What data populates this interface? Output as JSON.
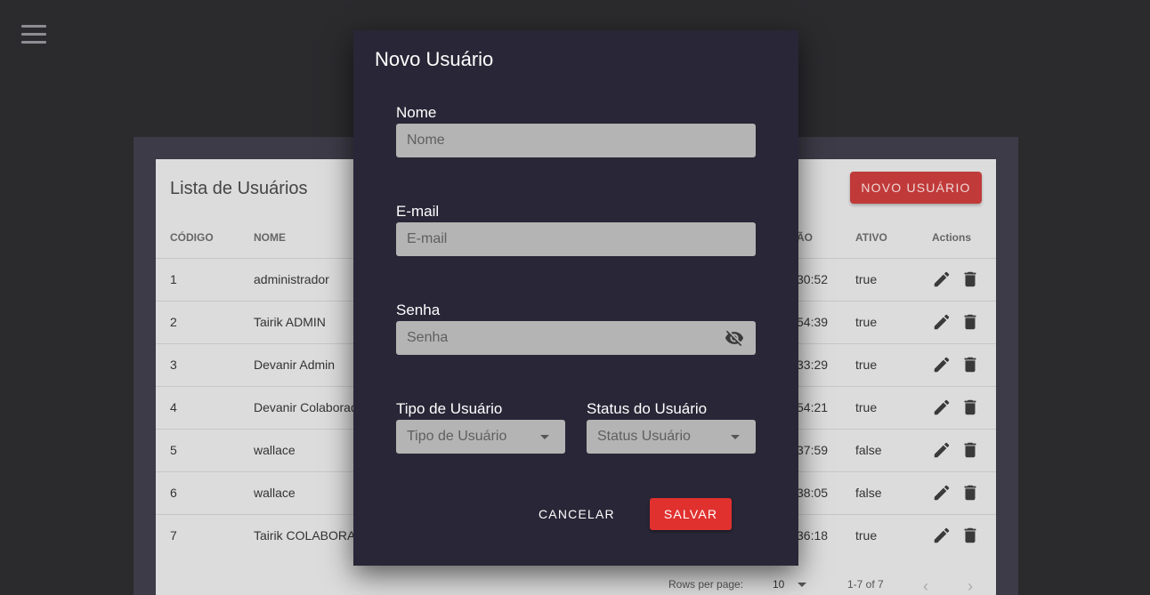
{
  "list": {
    "title": "Lista de Usuários",
    "new_button": "NOVO USUÁRIO",
    "headers": {
      "codigo": "CÓDIGO",
      "nome": "NOME",
      "partial": "ÃO",
      "ativo": "ATIVO",
      "actions": "Actions"
    },
    "rows": [
      {
        "codigo": "1",
        "nome": "administrador",
        "partial": "30:52",
        "ativo": "true"
      },
      {
        "codigo": "2",
        "nome": "Tairik ADMIN",
        "partial": "54:39",
        "ativo": "true"
      },
      {
        "codigo": "3",
        "nome": "Devanir Admin",
        "partial": "33:29",
        "ativo": "true"
      },
      {
        "codigo": "4",
        "nome": "Devanir Colaborad",
        "partial": "54:21",
        "ativo": "true"
      },
      {
        "codigo": "5",
        "nome": "wallace",
        "partial": "37:59",
        "ativo": "false"
      },
      {
        "codigo": "6",
        "nome": "wallace",
        "partial": "38:05",
        "ativo": "false"
      },
      {
        "codigo": "7",
        "nome": "Tairik COLABORA",
        "partial": "36:18",
        "ativo": "true"
      }
    ],
    "footer": {
      "rows_per_page_label": "Rows per page:",
      "rows_per_page_value": "10",
      "range": "1-7 of 7"
    }
  },
  "dialog": {
    "title": "Novo Usuário",
    "nome": {
      "label": "Nome",
      "placeholder": "Nome"
    },
    "email": {
      "label": "E-mail",
      "placeholder": "E-mail"
    },
    "senha": {
      "label": "Senha",
      "placeholder": "Senha"
    },
    "tipo": {
      "label": "Tipo de Usuário",
      "placeholder": "Tipo de Usuário"
    },
    "status": {
      "label": "Status do Usuário",
      "placeholder": "Status Usuário"
    },
    "cancel": "CANCELAR",
    "save": "SALVAR"
  },
  "icons": {
    "menu": "menu-icon",
    "edit": "pencil-icon",
    "delete": "trash-icon",
    "visibility": "eye-off-icon",
    "prev": "chevron-left-icon",
    "next": "chevron-right-icon"
  },
  "colors": {
    "primary_red": "#e0312f",
    "dialog_bg": "#292637",
    "app_bg": "#2b2b2e"
  }
}
